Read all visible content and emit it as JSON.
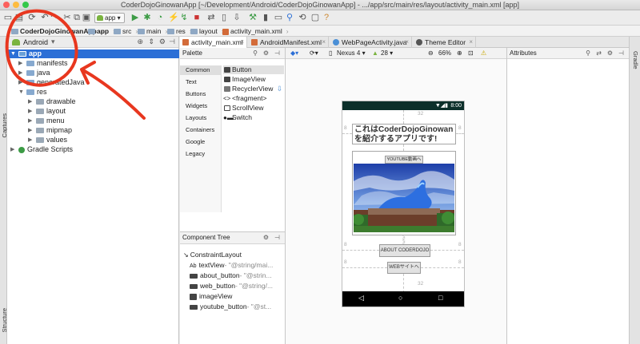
{
  "window": {
    "title": "CoderDojoGinowanApp [~/Development/Android/CoderDojoGinowanApp] - .../app/src/main/res/layout/activity_main.xml [app]"
  },
  "toolbar": {
    "run_config": "app"
  },
  "breadcrumb": {
    "items": [
      "CoderDojoGinowanApp",
      "app",
      "src",
      "main",
      "res",
      "layout",
      "activity_main.xml"
    ]
  },
  "left_strip": {
    "captures": "Captures",
    "structure": "Structure"
  },
  "right_strip": {
    "gradle": "Gradle"
  },
  "project": {
    "view_mode": "Android",
    "tree": [
      {
        "label": "app",
        "expanded": true,
        "selected": true
      },
      {
        "label": "manifests"
      },
      {
        "label": "java"
      },
      {
        "label": "generatedJava"
      },
      {
        "label": "res",
        "expanded": true
      },
      {
        "label": "drawable"
      },
      {
        "label": "layout"
      },
      {
        "label": "menu"
      },
      {
        "label": "mipmap"
      },
      {
        "label": "values"
      },
      {
        "label": "Gradle Scripts"
      }
    ]
  },
  "tabs": [
    {
      "label": "activity_main.xml",
      "active": true
    },
    {
      "label": "AndroidManifest.xml"
    },
    {
      "label": "WebPageActivity.java"
    },
    {
      "label": "Theme Editor"
    }
  ],
  "palette": {
    "title": "Palette",
    "categories": [
      "Common",
      "Text",
      "Buttons",
      "Widgets",
      "Layouts",
      "Containers",
      "Google",
      "Legacy"
    ],
    "widgets": [
      "Button",
      "ImageView",
      "RecyclerView",
      "<fragment>",
      "ScrollView",
      "Switch"
    ]
  },
  "component_tree": {
    "title": "Component Tree",
    "root": "ConstraintLayout",
    "items": [
      {
        "name": "textView",
        "value": "- \"@string/mai..."
      },
      {
        "name": "about_button",
        "value": "- \"@strin..."
      },
      {
        "name": "web_button",
        "value": "- \"@string/..."
      },
      {
        "name": "imageView",
        "value": ""
      },
      {
        "name": "youtube_button",
        "value": "- \"@st..."
      }
    ]
  },
  "design_toolbar": {
    "device": "Nexus 4",
    "api": "28",
    "zoom": "66%"
  },
  "phone": {
    "time": "8:00",
    "title_text": "これはCoderDojoGinowanを紹介するアプリです!",
    "youtube_button": "YOUTUBE動画へ",
    "about_button": "ABOUT CODERDOJO",
    "web_button": "WEBサイトへ",
    "margin_top": "32",
    "margin_side": "8",
    "margin_bottom": "32"
  },
  "attributes": {
    "title": "Attributes"
  },
  "colors": {
    "selection": "#2c6fd6",
    "annotation": "#e8371f",
    "status_bar": "#0c2f2a"
  }
}
